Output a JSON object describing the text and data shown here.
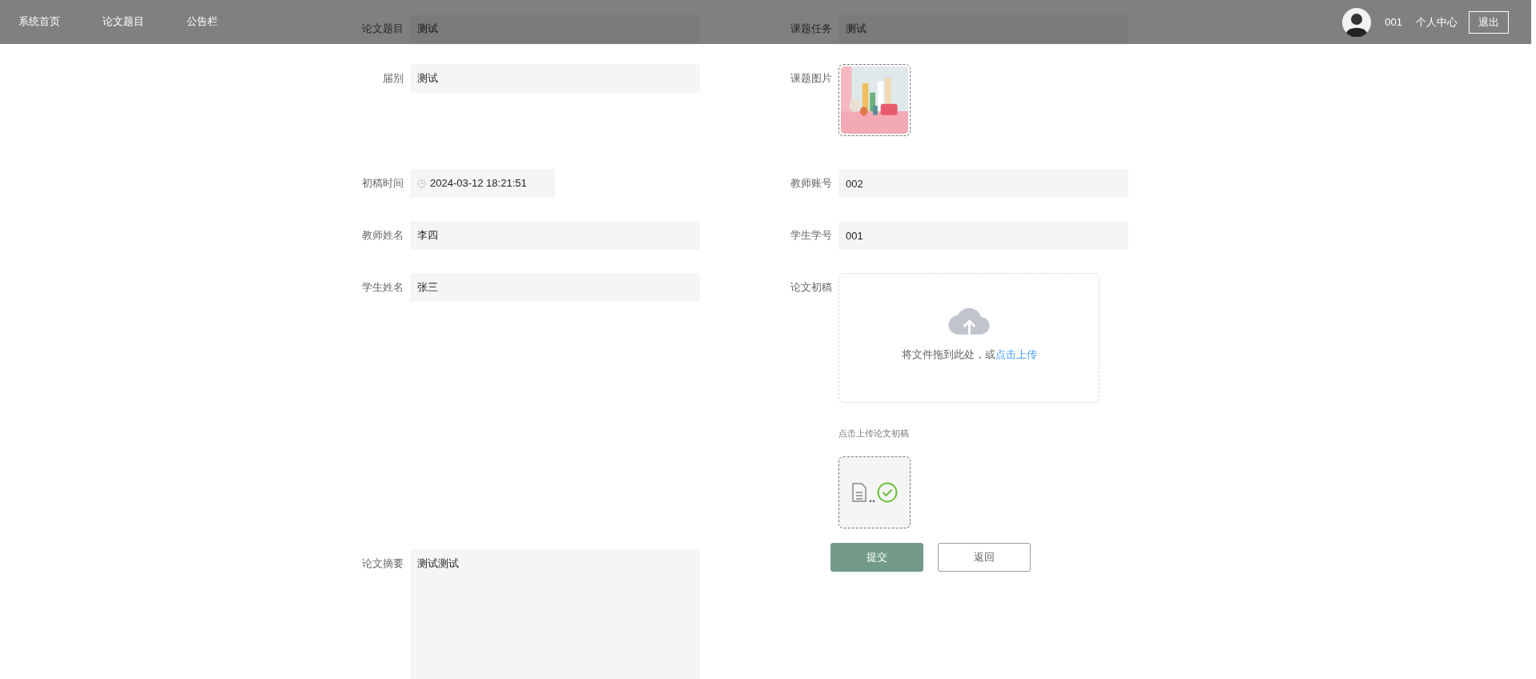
{
  "nav": {
    "items": [
      {
        "label": "系统首页"
      },
      {
        "label": "论文题目"
      },
      {
        "label": "公告栏"
      }
    ],
    "user": {
      "account": "001",
      "profile_link": "个人中心",
      "logout": "退出"
    }
  },
  "form": {
    "left": [
      {
        "kind": "text",
        "label": "论文题目",
        "value": "测试"
      },
      {
        "kind": "text",
        "label": "届别",
        "value": "测试"
      },
      {
        "kind": "datetime",
        "label": "初稿时间",
        "value": "2024-03-12 18:21:51"
      },
      {
        "kind": "text",
        "label": "教师姓名",
        "value": "李四"
      },
      {
        "kind": "text",
        "label": "学生姓名",
        "value": "张三"
      },
      {
        "kind": "textarea",
        "label": "论文摘要",
        "value": "测试测试"
      }
    ],
    "right": [
      {
        "kind": "text",
        "label": "课题任务",
        "value": "测试"
      },
      {
        "label": "课题图片"
      },
      {
        "kind": "text",
        "label": "教师账号",
        "value": "002"
      },
      {
        "kind": "text",
        "label": "学生学号",
        "value": "001"
      },
      {
        "kind": "upload",
        "label": "论文初稿",
        "drop_text": "将文件拖到此处，或",
        "link": "点击上传",
        "hint": "点击上传论文初稿",
        "file_name": ".."
      }
    ],
    "buttons": [
      {
        "kind": "primary",
        "label": "提交"
      },
      {
        "kind": "default",
        "label": "返回"
      }
    ]
  }
}
